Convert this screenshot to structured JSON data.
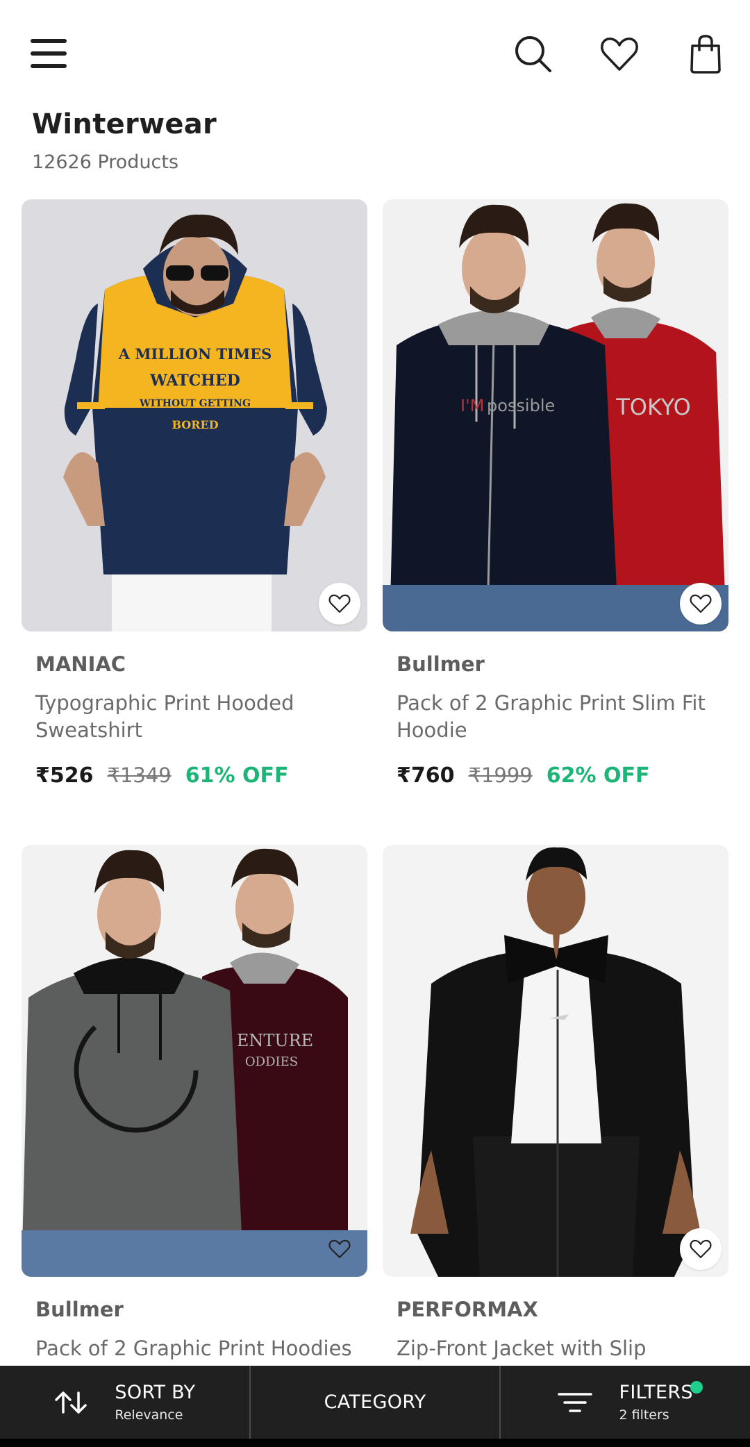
{
  "header": {
    "menu_icon": "hamburger-menu-icon",
    "search_icon": "search-icon",
    "wishlist_icon": "heart-icon",
    "bag_icon": "shopping-bag-icon"
  },
  "category": {
    "title": "Winterwear",
    "count": "12626 Products"
  },
  "products": [
    {
      "brand": "MANIAC",
      "name": "Typographic Print Hooded Sweatshirt",
      "price": "₹526",
      "mrp": "₹1349",
      "discount": "61% OFF",
      "print_lines": [
        "A MILLION TIMES",
        "WATCHED",
        "WITHOUT GETTING",
        "BORED"
      ]
    },
    {
      "brand": "Bullmer",
      "name": "Pack of 2 Graphic Print Slim Fit Hoodie",
      "price": "₹760",
      "mrp": "₹1999",
      "discount": "62% OFF",
      "print_lines": [
        "I'M",
        "possible",
        "TOKYO"
      ]
    },
    {
      "brand": "Bullmer",
      "name": "Pack of 2 Graphic Print Hoodies",
      "print_lines": [
        "ENTURE",
        "ODDIES"
      ]
    },
    {
      "brand": "PERFORMAX",
      "name": "Zip-Front Jacket with Slip Pockets"
    }
  ],
  "bottom_bar": {
    "sort": {
      "label": "SORT BY",
      "sub": "Relevance",
      "icon": "sort-arrows-icon"
    },
    "category": {
      "label": "CATEGORY"
    },
    "filters": {
      "label": "FILTERS",
      "sub": "2 filters",
      "icon": "filter-lines-icon"
    }
  },
  "colors": {
    "discount_green": "#1cb577",
    "bottom_bar_bg": "#202020",
    "filter_dot": "#1fd08c"
  }
}
